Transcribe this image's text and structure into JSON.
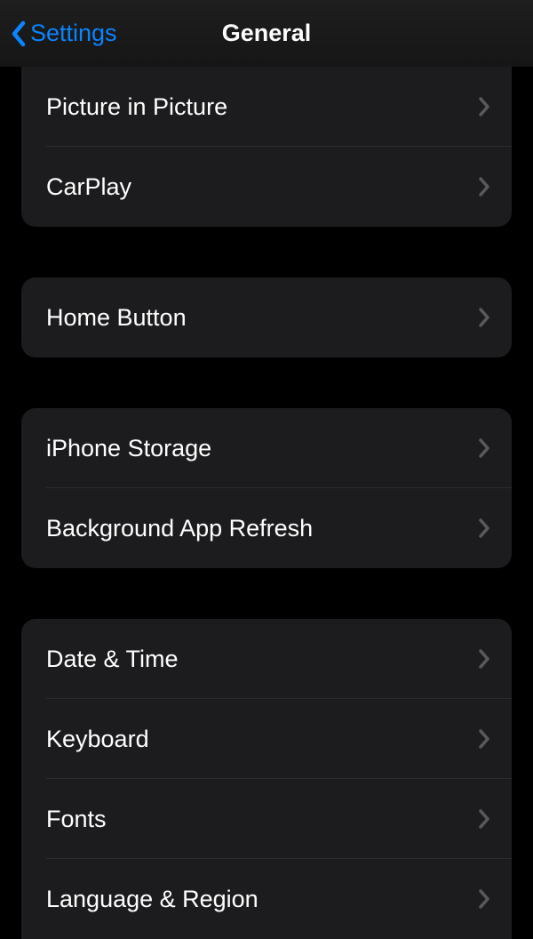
{
  "navbar": {
    "back_label": "Settings",
    "title": "General"
  },
  "groups": [
    {
      "items": [
        {
          "label": "Picture in Picture"
        },
        {
          "label": "CarPlay"
        }
      ]
    },
    {
      "items": [
        {
          "label": "Home Button"
        }
      ]
    },
    {
      "items": [
        {
          "label": "iPhone Storage"
        },
        {
          "label": "Background App Refresh"
        }
      ]
    },
    {
      "items": [
        {
          "label": "Date & Time"
        },
        {
          "label": "Keyboard"
        },
        {
          "label": "Fonts"
        },
        {
          "label": "Language & Region"
        }
      ]
    }
  ],
  "colors": {
    "accent": "#0a84ff",
    "background": "#000000",
    "group_background": "#1c1c1e",
    "text": "#ffffff",
    "chevron": "#5a5a5e"
  }
}
